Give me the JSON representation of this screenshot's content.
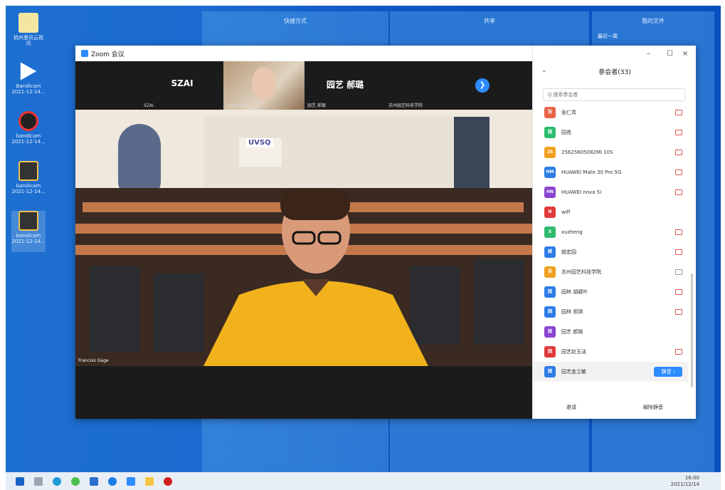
{
  "desktop": {
    "tiles": [
      {
        "label": "快捷方式"
      },
      {
        "label": "共享"
      },
      {
        "label": "我的文件",
        "sub": "最近一周"
      }
    ],
    "icons": [
      {
        "label": "杭州思讯云视讯"
      },
      {
        "label": "Bandicam 2021-12-14..."
      },
      {
        "label": "bandicam 2021-12-14..."
      },
      {
        "label": "bandicam 2021-12-14..."
      },
      {
        "label": "bandicam 2021-12-14..."
      }
    ]
  },
  "window": {
    "title": "Zoom 会议",
    "controls": {
      "minimize": "–",
      "maximize": "☐",
      "close": "×"
    }
  },
  "strip": {
    "thumbs": [
      {
        "name": "SZAI",
        "sub": "SZAI"
      },
      {
        "name": "",
        "sub": "Yuhan DOU"
      },
      {
        "name": "园艺 郝璐",
        "sub": "园艺 郝璐"
      },
      {
        "name": "",
        "sub": "苏州园艺科技学院"
      }
    ],
    "next": "❯"
  },
  "video": {
    "speaker_name": "Francois Gage",
    "sign_text": "UVSQ"
  },
  "panel": {
    "title": "参会者(33)",
    "search_placeholder": "Q 搜索参会者",
    "participants": [
      {
        "name": "张仁青",
        "avatar": "张",
        "color": "#e8644a",
        "icon": "red"
      },
      {
        "name": "园苑",
        "avatar": "园",
        "color": "#2dbb6e",
        "icon": "red"
      },
      {
        "name": "25625605082Mi 10S",
        "avatar": "25",
        "color": "#f0a020",
        "icon": "red"
      },
      {
        "name": "HUAWEI Mate 30 Pro 5G",
        "avatar": "HM",
        "color": "#2d7ce6",
        "icon": "red"
      },
      {
        "name": "HUAWEI nova 5i",
        "avatar": "HN",
        "color": "#8a44d0",
        "icon": "red"
      },
      {
        "name": "wiff",
        "avatar": "N",
        "color": "#e03a3a",
        "icon": ""
      },
      {
        "name": "xuzheng",
        "avatar": "X",
        "color": "#2dbb6e",
        "icon": "red"
      },
      {
        "name": "姚宏园",
        "avatar": "姚",
        "color": "#2d7ce6",
        "icon": "red"
      },
      {
        "name": "苏州园艺科技学院",
        "avatar": "苏",
        "color": "#f0a020",
        "icon": "gray"
      },
      {
        "name": "园林 胡颖叶",
        "avatar": "园",
        "color": "#2d7ce6",
        "icon": "red"
      },
      {
        "name": "园林 郑琪",
        "avatar": "园",
        "color": "#2d7ce6",
        "icon": "red"
      },
      {
        "name": "园艺 郝璐",
        "avatar": "园",
        "color": "#8a44d0",
        "icon": ""
      },
      {
        "name": "园艺赵玉洁",
        "avatar": "园",
        "color": "#e03a3a",
        "icon": "red"
      },
      {
        "name": "园艺金立敏",
        "avatar": "园",
        "color": "#2d7ce6",
        "icon": "",
        "admit": "静音 ›"
      }
    ],
    "footer": {
      "invite": "邀请",
      "unmute": "解除静音"
    }
  },
  "taskbar": {
    "time": "16:00",
    "date": "2021/12/14"
  }
}
